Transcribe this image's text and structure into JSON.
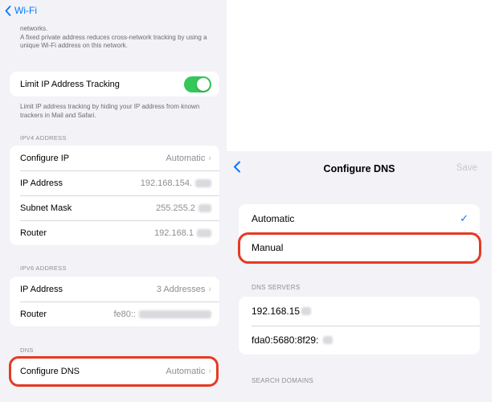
{
  "left": {
    "back_label": "Wi-Fi",
    "private_note": "networks.\nA fixed private address reduces cross-network tracking by using a unique Wi-Fi address on this network.",
    "limit_tracking": {
      "label": "Limit IP Address Tracking",
      "enabled": true
    },
    "limit_note": "Limit IP address tracking by hiding your IP address from known trackers in Mail and Safari.",
    "ipv4": {
      "header": "IPV4 ADDRESS",
      "rows": [
        {
          "label": "Configure IP",
          "value": "Automatic"
        },
        {
          "label": "IP Address",
          "value": "192.168.154."
        },
        {
          "label": "Subnet Mask",
          "value": "255.255.2"
        },
        {
          "label": "Router",
          "value": "192.168.1"
        }
      ]
    },
    "ipv6": {
      "header": "IPV6 ADDRESS",
      "rows": [
        {
          "label": "IP Address",
          "value": "3 Addresses"
        },
        {
          "label": "Router",
          "value": "fe80::"
        }
      ]
    },
    "dns": {
      "header": "DNS",
      "row": {
        "label": "Configure DNS",
        "value": "Automatic"
      }
    }
  },
  "right": {
    "title": "Configure DNS",
    "save_label": "Save",
    "modes": [
      {
        "label": "Automatic",
        "selected": true
      },
      {
        "label": "Manual",
        "selected": false
      }
    ],
    "servers_header": "DNS SERVERS",
    "servers": [
      "192.168.15",
      "fda0:5680:8f29:"
    ],
    "search_header": "SEARCH DOMAINS"
  },
  "colors": {
    "accent": "#007aff",
    "toggle_on": "#34c759",
    "highlight": "#e63a22"
  },
  "icons": {
    "back": "chevron-left-icon",
    "disclosure": "chevron-right-icon",
    "check": "checkmark-icon"
  }
}
